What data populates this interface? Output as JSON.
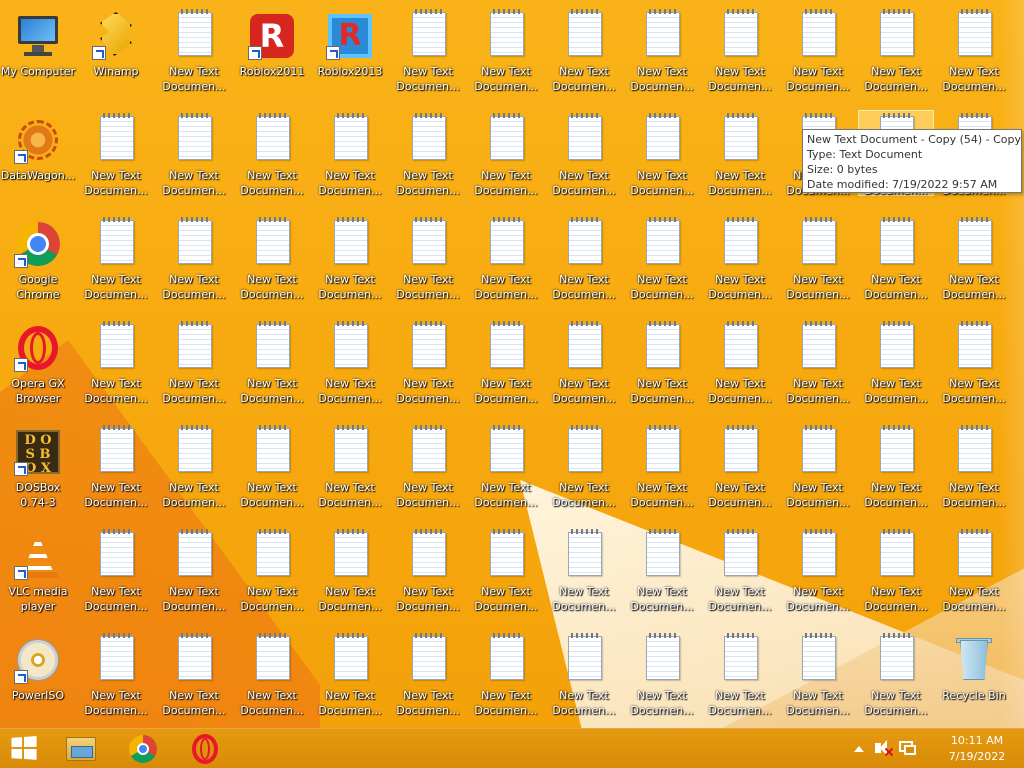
{
  "desktop": {
    "special_icons": [
      {
        "name": "my-computer-icon",
        "label": "My Computer",
        "kind": "mycomputer",
        "col": 0,
        "row": 0,
        "shortcut": false
      },
      {
        "name": "winamp-icon",
        "label": "Winamp",
        "kind": "winamp",
        "col": 1,
        "row": 0,
        "shortcut": true
      },
      {
        "name": "roblox2011-icon",
        "label": "Roblox2011",
        "kind": "roblox",
        "col": 3,
        "row": 0,
        "shortcut": true
      },
      {
        "name": "roblox2013-icon",
        "label": "Roblox2013",
        "kind": "roblox2",
        "col": 4,
        "row": 0,
        "shortcut": true
      },
      {
        "name": "datawagon-icon",
        "label": "DataWagon...",
        "kind": "datawagon",
        "col": 0,
        "row": 1,
        "shortcut": true
      },
      {
        "name": "google-chrome-icon",
        "label": "Google Chrome",
        "kind": "chrome",
        "col": 0,
        "row": 2,
        "shortcut": true
      },
      {
        "name": "opera-gx-icon",
        "label": "Opera GX Browser",
        "kind": "opera",
        "col": 0,
        "row": 3,
        "shortcut": true
      },
      {
        "name": "dosbox-icon",
        "label": "DOSBox 0.74-3",
        "kind": "dosbox",
        "col": 0,
        "row": 4,
        "shortcut": true
      },
      {
        "name": "vlc-icon",
        "label": "VLC media player",
        "kind": "vlc",
        "col": 0,
        "row": 5,
        "shortcut": true
      },
      {
        "name": "poweriso-icon",
        "label": "PowerISO",
        "kind": "poweriso",
        "col": 0,
        "row": 6,
        "shortcut": true
      },
      {
        "name": "recycle-bin-icon",
        "label": "Recycle Bin",
        "kind": "recycle",
        "col": 12,
        "row": 6,
        "shortcut": false
      }
    ],
    "document_label": "New Text Documen...",
    "document_label_first": "New Text",
    "document_label_second": "Documen..."
  },
  "tooltip": {
    "title": "New Text Document - Copy (54) - Copy",
    "type": "Type: Text Document",
    "size": "Size: 0 bytes",
    "modified": "Date modified: 7/19/2022 9:57 AM"
  },
  "taskbar": {
    "pinned": [
      "start-button",
      "file-explorer",
      "google-chrome",
      "opera-gx"
    ],
    "clock_time": "10:11 AM",
    "clock_date": "7/19/2022"
  }
}
